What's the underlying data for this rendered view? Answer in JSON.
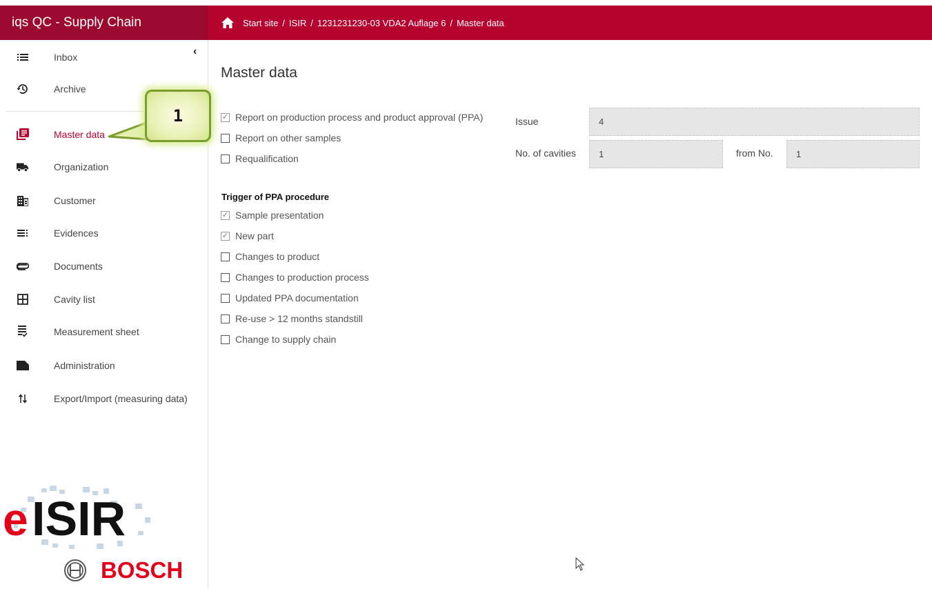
{
  "app": {
    "title": "iqs QC - Supply Chain"
  },
  "breadcrumb": [
    "Start site",
    "ISIR",
    "1231231230-03 VDA2 Auflage 6",
    "Master data"
  ],
  "sidebar": {
    "collapse_label": "‹",
    "items": [
      {
        "label": "Inbox",
        "icon": "list-icon"
      },
      {
        "label": "Archive",
        "icon": "history-icon"
      },
      {
        "label": "Master data",
        "icon": "master-data-icon",
        "active": true
      },
      {
        "label": "Organization",
        "icon": "truck-icon"
      },
      {
        "label": "Customer",
        "icon": "building-icon"
      },
      {
        "label": "Evidences",
        "icon": "evidences-icon"
      },
      {
        "label": "Documents",
        "icon": "paperclip-icon"
      },
      {
        "label": "Cavity list",
        "icon": "grid-icon"
      },
      {
        "label": "Measurement sheet",
        "icon": "sheet-icon"
      },
      {
        "label": "Administration",
        "icon": "folder-icon"
      },
      {
        "label": "Export/Import (measuring data)",
        "icon": "import-export-icon"
      }
    ]
  },
  "callout": {
    "label": "1"
  },
  "logo": {
    "eisir_e": "e",
    "eisir_rest": "ISIR",
    "bosch": "BOSCH"
  },
  "main": {
    "title": "Master data",
    "report_options": [
      {
        "label": "Report on production process and product approval (PPA)",
        "checked": true
      },
      {
        "label": "Report on other samples",
        "checked": false
      },
      {
        "label": "Requalification",
        "checked": false
      }
    ],
    "trigger_title": "Trigger of PPA procedure",
    "triggers": [
      {
        "label": "Sample presentation",
        "checked": true
      },
      {
        "label": "New part",
        "checked": true
      },
      {
        "label": "Changes to product",
        "checked": false
      },
      {
        "label": "Changes to production process",
        "checked": false
      },
      {
        "label": "Updated PPA documentation",
        "checked": false
      },
      {
        "label": "Re-use > 12 months standstill",
        "checked": false
      },
      {
        "label": "Change to supply chain",
        "checked": false
      }
    ],
    "issue_label": "Issue",
    "issue_value": "4",
    "cavities_label": "No. of cavities",
    "cavities_value": "1",
    "from_label": "from No.",
    "from_value": "1"
  },
  "colors": {
    "brand": "#9d0a2f",
    "topbar": "#b5022f",
    "active": "#b5022f"
  }
}
